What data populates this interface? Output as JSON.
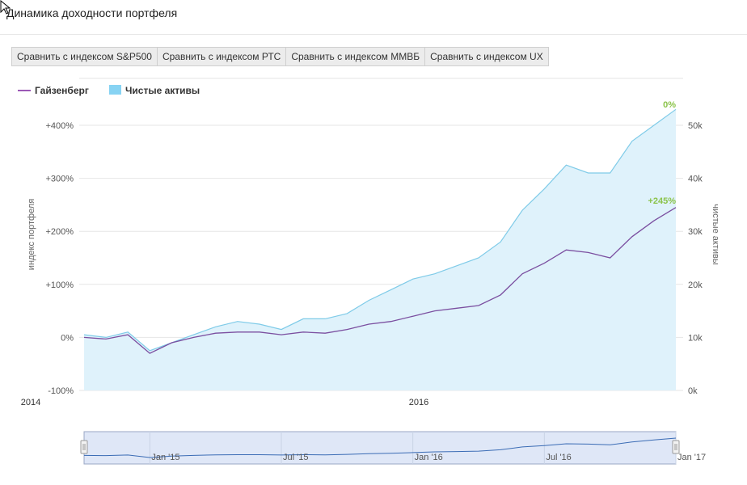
{
  "page": {
    "title": "Динамика доходности портфеля",
    "compare_buttons": [
      "Сравнить с индексом S&P500",
      "Сравнить с индексом РТС",
      "Сравнить с индексом ММВБ",
      "Сравнить с индексом UX"
    ]
  },
  "chart_data": {
    "type": "line",
    "legend": [
      {
        "name": "Гайзенберг",
        "color": "#9b59b6",
        "kind": "line"
      },
      {
        "name": "Чистые активы",
        "color": "#87d3f3",
        "kind": "area"
      }
    ],
    "ylabel_left": "индекс портфеля",
    "ylabel_right": "чистые активы",
    "yticks_left": [
      "+400%",
      "+300%",
      "+200%",
      "+100%",
      "0%",
      "-100%"
    ],
    "yticks_right": [
      "50k",
      "40k",
      "30k",
      "20k",
      "10k",
      "0k"
    ],
    "xticks": [
      "2014",
      "2016"
    ],
    "ylim_left": [
      -100,
      400
    ],
    "ylim_right": [
      0,
      50000
    ],
    "x_range": [
      "2014-10",
      "2017-01"
    ],
    "end_labels": {
      "net_assets": "0%",
      "portfolio": "+245%"
    },
    "navigator_labels": [
      "Jan '15",
      "Jul '15",
      "Jan '16",
      "Jul '16",
      "Jan '17"
    ],
    "series": [
      {
        "name": "Гайзенберг",
        "x": [
          "2014-10",
          "2014-11",
          "2014-12",
          "2015-01",
          "2015-02",
          "2015-03",
          "2015-04",
          "2015-05",
          "2015-06",
          "2015-07",
          "2015-08",
          "2015-09",
          "2015-10",
          "2015-11",
          "2015-12",
          "2016-01",
          "2016-02",
          "2016-03",
          "2016-04",
          "2016-05",
          "2016-06",
          "2016-07",
          "2016-08",
          "2016-09",
          "2016-10",
          "2016-11",
          "2016-12",
          "2017-01"
        ],
        "values": [
          0,
          -3,
          5,
          -30,
          -10,
          0,
          8,
          10,
          10,
          5,
          10,
          8,
          15,
          25,
          30,
          40,
          50,
          55,
          60,
          80,
          120,
          140,
          165,
          160,
          150,
          190,
          220,
          245
        ]
      },
      {
        "name": "Чистые активы",
        "x": [
          "2014-10",
          "2014-11",
          "2014-12",
          "2015-01",
          "2015-02",
          "2015-03",
          "2015-04",
          "2015-05",
          "2015-06",
          "2015-07",
          "2015-08",
          "2015-09",
          "2015-10",
          "2015-11",
          "2015-12",
          "2016-01",
          "2016-02",
          "2016-03",
          "2016-04",
          "2016-05",
          "2016-06",
          "2016-07",
          "2016-08",
          "2016-09",
          "2016-10",
          "2016-11",
          "2016-12",
          "2017-01"
        ],
        "values": [
          10500,
          10000,
          11000,
          7500,
          9000,
          10500,
          12000,
          13000,
          12500,
          11500,
          13500,
          13500,
          14500,
          17000,
          19000,
          21000,
          22000,
          23500,
          25000,
          28000,
          34000,
          38000,
          42500,
          41000,
          41000,
          47000,
          50000,
          53000
        ]
      }
    ]
  }
}
